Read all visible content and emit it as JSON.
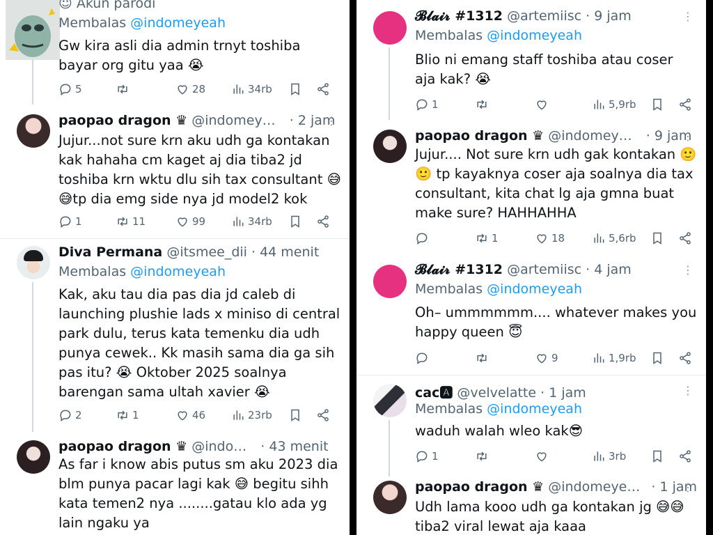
{
  "left": {
    "top_partial": {
      "label": "Akun parodi",
      "reply_prefix": "Membalas",
      "reply_to": "@indomeyeah",
      "text": "Gw kira asli dia admin trnyt toshiba bayar org gitu yaa 😭",
      "replies": "5",
      "retweets": "",
      "likes": "28",
      "views": "34rb"
    },
    "tweets": [
      {
        "name": "paopao dragon ♛",
        "handle": "@indomey…",
        "time": "· 2 jam",
        "text": "Jujur...not sure krn aku udh ga kontakan kak hahaha cm kaget aj dia tiba2 jd toshiba krn wktu dlu sih tax consultant 😅 😅tp dia emg side nya jd model2 kok",
        "replies": "1",
        "retweets": "11",
        "likes": "99",
        "views": "34rb"
      },
      {
        "name": "Diva Permana",
        "handle": "@itsmee_dii",
        "time": "· 44 menit",
        "reply_prefix": "Membalas",
        "reply_to": "@indomeyeah",
        "text": "Kak, aku tau dia pas dia jd caleb di launching plushie lads x miniso di central park dulu, terus kata temenku dia udh punya cewek.. Kk masih sama dia ga sih pas itu? 😭 Oktober 2025 soalnya barengan sama ultah xavier 😭",
        "replies": "2",
        "retweets": "1",
        "likes": "46",
        "views": "23rb"
      },
      {
        "name": "paopao dragon ♛",
        "handle": "@indo…",
        "time": "· 43 menit",
        "text": "As far i know abis putus sm aku 2023 dia blm punya pacar lagi kak 😅 begitu sihh kata temen2 nya ........gatau klo ada yg lain ngaku ya"
      }
    ]
  },
  "right": {
    "tweets": [
      {
        "name": "𝓑𝓵𝓪𝓲𝓻 #1312",
        "handle": "@artemiisc",
        "time": "· 9 jam",
        "reply_prefix": "Membalas",
        "reply_to": "@indomeyeah",
        "text": "Blio ni emang staff toshiba atau coser aja kak? 😭",
        "replies": "1",
        "retweets": "",
        "likes": "",
        "views": "5,9rb"
      },
      {
        "name": "paopao dragon ♛",
        "handle": "@indomey…",
        "time": "· 9 jam",
        "text": "Jujur.... Not sure krn udh gak kontakan 🙂 🙂 tp kayaknya coser aja soalnya dia tax consultant, kita chat lg aja gmna buat make sure? HAHHAHHA",
        "replies": "",
        "retweets": "1",
        "likes": "18",
        "views": "5,6rb"
      },
      {
        "name": "𝓑𝓵𝓪𝓲𝓻 #1312",
        "handle": "@artemiisc",
        "time": "· 4 jam",
        "reply_prefix": "Membalas",
        "reply_to": "@indomeyeah",
        "text": "Oh– ummmmmm.... whatever makes you happy queen 😇",
        "replies": "",
        "retweets": "",
        "likes": "9",
        "views": "1,9rb"
      },
      {
        "name": "cac🅰",
        "handle": "@velvelatte",
        "time": "· 1 jam",
        "reply_prefix": "Membalas",
        "reply_to": "@indomeyeah",
        "text": "waduh walah wleo kak😎",
        "replies": "1",
        "retweets": "",
        "likes": "",
        "views": "3rb"
      },
      {
        "name": "paopao dragon ♛",
        "handle": "@indomeye…",
        "time": "· 1 jam",
        "text": "Udh lama kooo udh ga kontakan jg 😅😅 tiba2 viral lewat aja kaaa"
      }
    ]
  },
  "colors": {
    "link": "#1d9bf0",
    "muted": "#536471",
    "text": "#0f1419",
    "separator": "#000000",
    "avatar_pink": "#e5317f"
  }
}
